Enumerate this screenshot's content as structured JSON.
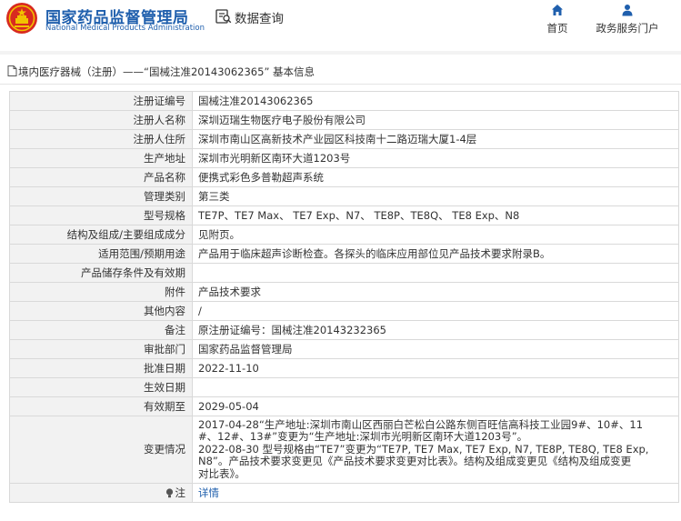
{
  "header": {
    "logo_cn": "国家药品监督管理局",
    "logo_en": "National Medical Products Administration",
    "query_label": "数据查询",
    "nav": [
      {
        "label": "首页",
        "icon": "home-icon"
      },
      {
        "label": "政务服务门户",
        "icon": "user-icon"
      }
    ]
  },
  "breadcrumb": {
    "text": "境内医疗器械（注册）——“国械注准20143062365” 基本信息"
  },
  "rows": [
    {
      "label": "注册证编号",
      "value": "国械注准20143062365"
    },
    {
      "label": "注册人名称",
      "value": "深圳迈瑞生物医疗电子股份有限公司"
    },
    {
      "label": "注册人住所",
      "value": "深圳市南山区高新技术产业园区科技南十二路迈瑞大厦1-4层"
    },
    {
      "label": "生产地址",
      "value": "深圳市光明新区南环大道1203号"
    },
    {
      "label": "产品名称",
      "value": "便携式彩色多普勒超声系统"
    },
    {
      "label": "管理类别",
      "value": "第三类"
    },
    {
      "label": "型号规格",
      "value": "TE7P、TE7 Max、 TE7 Exp、N7、 TE8P、TE8Q、 TE8 Exp、N8"
    },
    {
      "label": "结构及组成/主要组成成分",
      "value": "见附页。"
    },
    {
      "label": "适用范围/预期用途",
      "value": "产品用于临床超声诊断检查。各探头的临床应用部位见产品技术要求附录B。"
    },
    {
      "label": "产品储存条件及有效期",
      "value": ""
    },
    {
      "label": "附件",
      "value": "产品技术要求"
    },
    {
      "label": "其他内容",
      "value": "/"
    },
    {
      "label": "备注",
      "value": "原注册证编号：国械注准20143232365"
    },
    {
      "label": "审批部门",
      "value": "国家药品监督管理局"
    },
    {
      "label": "批准日期",
      "value": "2022-11-10"
    },
    {
      "label": "生效日期",
      "value": ""
    },
    {
      "label": "有效期至",
      "value": "2029-05-04"
    },
    {
      "label": "变更情况",
      "value_lines": [
        "2017-04-28“生产地址:深圳市南山区西丽白芒松白公路东侧百旺信高科技工业园9#、10#、11",
        "#、12#、13#”变更为“生产地址:深圳市光明新区南环大道1203号”。",
        "2022-08-30 型号规格由“TE7”变更为“TE7P, TE7 Max, TE7 Exp, N7, TE8P, TE8Q, TE8 Exp,",
        "N8”。产品技术要求变更见《产品技术要求变更对比表》。结构及组成变更见《结构及组成变更",
        "对比表》。"
      ]
    },
    {
      "label": "注",
      "link": "详情"
    }
  ]
}
